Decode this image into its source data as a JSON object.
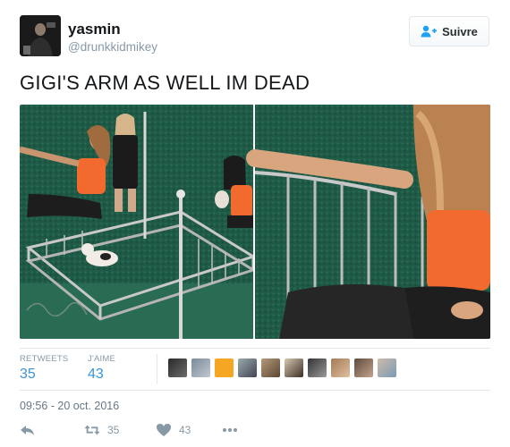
{
  "user": {
    "name": "yasmin",
    "handle": "@drunkkidmikey"
  },
  "follow_button": {
    "label": "Suivre"
  },
  "tweet": {
    "text": "GIGI'S ARM AS WELL IM DEAD"
  },
  "stats": {
    "retweets_label": "RETWEETS",
    "retweets_count": "35",
    "likes_label": "J'AIME",
    "likes_count": "43"
  },
  "timestamp": "09:56 - 20 oct. 2016",
  "actions": {
    "retweet_count": "35",
    "like_count": "43"
  },
  "colors": {
    "link_blue": "#3b94d9",
    "muted": "#8899a6",
    "green_wall": "#1f5a46",
    "orange_top": "#f26a2e"
  },
  "icons": [
    "add-user-icon",
    "reply-icon",
    "retweet-icon",
    "heart-icon",
    "more-icon"
  ]
}
